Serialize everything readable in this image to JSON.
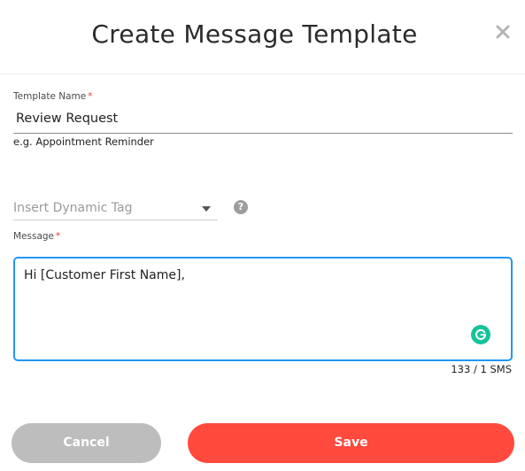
{
  "dialog": {
    "title": "Create Message Template",
    "close_icon": "close-icon"
  },
  "template_name": {
    "label": "Template Name",
    "required_mark": "*",
    "value": "Review Request",
    "hint": "e.g. Appointment Reminder"
  },
  "dynamic_tag": {
    "placeholder": "Insert Dynamic Tag",
    "caret_icon": "caret-down-icon",
    "help_icon": "question-mark-icon",
    "help_glyph": "?"
  },
  "message": {
    "label": "Message",
    "required_mark": "*",
    "value": "Hi [Customer First Name],",
    "grammarly_icon": "grammarly-icon",
    "counter": "133 / 1 SMS"
  },
  "actions": {
    "cancel_label": "Cancel",
    "save_label": "Save"
  },
  "colors": {
    "save_button": "#ff4a3d",
    "cancel_button": "#bdbdbd",
    "focus_border": "#2196f3",
    "required_mark": "#e53935",
    "grammarly": "#15c39a"
  }
}
